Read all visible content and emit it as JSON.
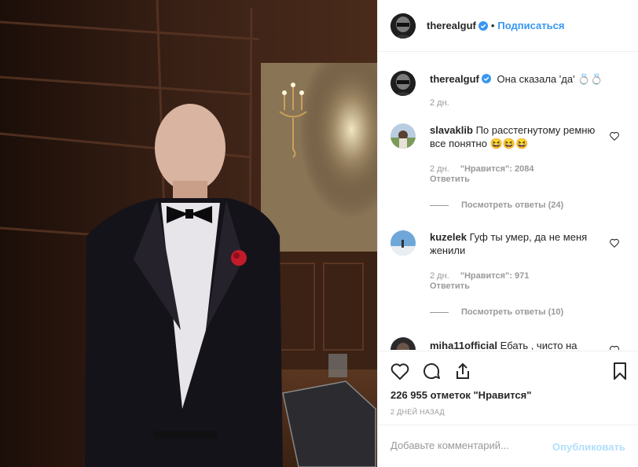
{
  "post": {
    "username": "therealguf",
    "follow_label": "Подписаться",
    "dot": "•"
  },
  "caption": {
    "username": "therealguf",
    "text": "Она сказала 'да' 💍💍",
    "time": "2 дн."
  },
  "comments": [
    {
      "username": "slavaklib",
      "text": "По расстегнутому ремню все понятно 😆😆😆",
      "time": "2 дн.",
      "likes": "\"Нравится\": 2084",
      "reply_label": "Ответить",
      "view_replies": "Посмотреть ответы (24)"
    },
    {
      "username": "kuzelek",
      "text": "Гуф ты умер, да не меня женили",
      "time": "2 дн.",
      "likes": "\"Нравится\": 971",
      "reply_label": "Ответить",
      "view_replies": "Посмотреть ответы (10)"
    },
    {
      "username": "miha11official",
      "text": "Ебать , чисто на"
    }
  ],
  "actions": {
    "like_icon": "heart-icon",
    "comment_icon": "comment-icon",
    "share_icon": "share-icon",
    "save_icon": "bookmark-icon",
    "likes_text": "226 955 отметок \"Нравится\"",
    "time_ago": "2 ДНЕЙ НАЗАД"
  },
  "add_comment": {
    "placeholder": "Добавьте комментарий...",
    "publish_label": "Опубликовать"
  },
  "colors": {
    "accent": "#3897f0",
    "publish_disabled": "#b2dffc",
    "muted": "#999999",
    "text": "#262626"
  }
}
